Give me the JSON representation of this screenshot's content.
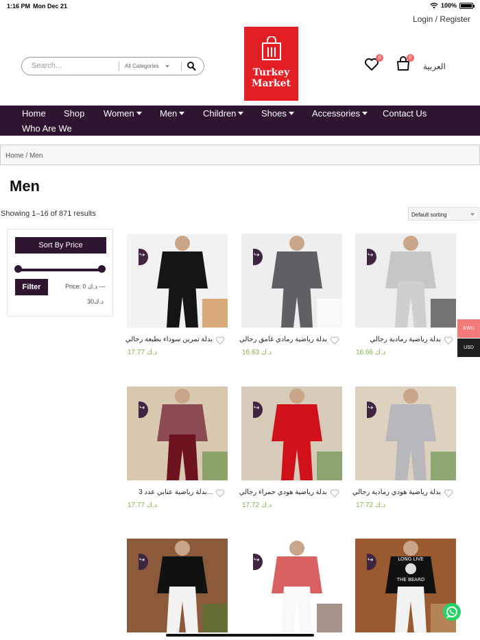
{
  "status_bar": {
    "time": "1:16 PM",
    "date": "Mon Dec 21",
    "battery": "100%",
    "battery_level": 1.0
  },
  "header": {
    "login_label": "Login / Register",
    "search": {
      "placeholder": "Search...",
      "category": "All Categories"
    },
    "logo": {
      "line1": "Turkey",
      "line2": "Market"
    },
    "wishlist_count": "0",
    "cart_count": "0",
    "language": "العربية"
  },
  "nav": [
    {
      "label": "Home",
      "dropdown": false
    },
    {
      "label": "Shop",
      "dropdown": false
    },
    {
      "label": "Women",
      "dropdown": true
    },
    {
      "label": "Men",
      "dropdown": true
    },
    {
      "label": "Children",
      "dropdown": true
    },
    {
      "label": "Shoes",
      "dropdown": true
    },
    {
      "label": "Accessories",
      "dropdown": true
    },
    {
      "label": "Contact Us",
      "dropdown": false
    },
    {
      "label": "Who Are We",
      "dropdown": false
    }
  ],
  "breadcrumb": {
    "home": "Home",
    "separator": "/",
    "current": "Men"
  },
  "page_title": "Men",
  "results_text": "Showing 1–16 of 871 results",
  "sorting": {
    "selected": "Default sorting"
  },
  "filter": {
    "title": "Sort By Price",
    "button": "Filter",
    "price_text": "Price: 0 د.ك —",
    "price_max": "30د.ك"
  },
  "products": [
    {
      "name": "بدلة تمرين سوداء بطبعة رجالي",
      "price": "17.77 د.ك",
      "colors": {
        "bg": "#f2f2f2",
        "top": "#151515",
        "pants": "#151515",
        "accent": "#c8782a"
      }
    },
    {
      "name": "بدلة رياضية رمادي غامق رجالي",
      "price": "16.63 د.ك",
      "colors": {
        "bg": "#eeeeee",
        "top": "#5e6064",
        "pants": "#5e6064",
        "accent": "#ffffff"
      }
    },
    {
      "name": "بدلة رياضية رمادية رجالي",
      "price": "16.66 د.ك",
      "colors": {
        "bg": "#ededed",
        "top": "#c6c6c8",
        "pants": "#cfcfd1",
        "accent": "#222222"
      }
    },
    {
      "name": "بدلة رياضية عنابي عدد 3...",
      "price": "17.77 د.ك",
      "colors": {
        "bg": "#d8c8b0",
        "top": "#8c4a52",
        "pants": "#6e1420",
        "accent": "#5a8a3a"
      }
    },
    {
      "name": "بدلة رياضية هودي حمراء رجالي",
      "price": "17.72 د.ك",
      "colors": {
        "bg": "#d6cab8",
        "top": "#d1111a",
        "pants": "#d1111a",
        "accent": "#5a8a3a"
      }
    },
    {
      "name": "بدلة رياضية هودي رمادية رجالي",
      "price": "17.72 د.ك",
      "colors": {
        "bg": "#ddd2c0",
        "top": "#b8b8bc",
        "pants": "#b8b8bc",
        "accent": "#5a8a3a"
      }
    },
    {
      "name": "",
      "price": "",
      "colors": {
        "bg": "#8a5a3a",
        "top": "#111111",
        "pants": "#f2f2f2",
        "accent": "#4c7a32"
      }
    },
    {
      "name": "",
      "price": "",
      "colors": {
        "bg": "#ffffff",
        "top": "#d96060",
        "pants": "#f8f8f8",
        "accent": "#6a4a3a"
      }
    },
    {
      "name": "",
      "price": "",
      "colors": {
        "bg": "#9a5a30",
        "top": "#111111",
        "pants": "#f2f2f2",
        "accent": "#c8a070"
      },
      "print": {
        "line1": "LONG LIVE",
        "line2": "THE BEARD"
      }
    }
  ],
  "currencies": [
    "KWD",
    "USD"
  ],
  "colors": {
    "brand": "#2e1530",
    "logo_red": "#e31e24",
    "price_green": "#7cb342",
    "badge": "#f46b6b",
    "kwd_tab": "#f47a7a"
  }
}
